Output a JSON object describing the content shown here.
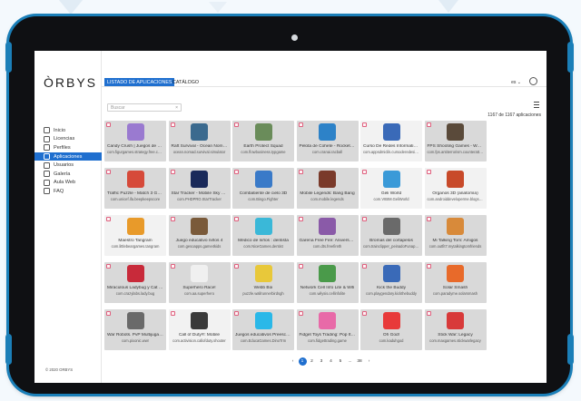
{
  "app": {
    "logo": "ÒRBYS",
    "copyright": "© 2020 ORBYS"
  },
  "tabs": [
    {
      "label": "LISTADO DE APLICACIONES",
      "active": true
    },
    {
      "label": "CATÁLOGO",
      "active": false
    }
  ],
  "header": {
    "language": "es ⌄"
  },
  "sidebar": {
    "items": [
      {
        "label": "Inicio",
        "icon": "home-icon",
        "active": false
      },
      {
        "label": "Licencias",
        "icon": "license-icon",
        "active": false
      },
      {
        "label": "Perfiles",
        "icon": "profiles-icon",
        "active": false
      },
      {
        "label": "Aplicaciones",
        "icon": "apps-icon",
        "active": true
      },
      {
        "label": "Usuarios",
        "icon": "users-icon",
        "active": false
      },
      {
        "label": "Galería",
        "icon": "gallery-icon",
        "active": false
      },
      {
        "label": "Aula Web",
        "icon": "globe-icon",
        "active": false
      },
      {
        "label": "FAQ",
        "icon": "help-icon",
        "active": false
      }
    ]
  },
  "search": {
    "placeholder": "Buscar",
    "clear": "×"
  },
  "results": {
    "count": "1167 de 1167 aplicaciones"
  },
  "apps": [
    {
      "title": "Candy Crush | Juegos de Gusims",
      "pkg": "com.figurgames.strategy.free.castles",
      "color": "#9a7ad0"
    },
    {
      "title": "Raft Survival - Ocean Nomad",
      "pkg": "ocean.nomad.survival.simulator",
      "color": "#3b6a8e"
    },
    {
      "title": "Earth Protect Squad",
      "pkg": "com.flowbusiness.typgame",
      "color": "#6a8c5a"
    },
    {
      "title": "Pelota de Cohete - Rocket Car",
      "pkg": "com.cranai.racball",
      "color": "#2d82c8"
    },
    {
      "title": "Curso De Redes Informaticas",
      "pkg": "com.appsdmiclik.cursoderedesinfor...",
      "color": "#3a6ab8",
      "selected": true
    },
    {
      "title": "FPS Shooting Games - War Games",
      "pkg": "com.fps.antiterrorism.counterattack.s...",
      "color": "#5a4a3a"
    },
    {
      "title": "Traffic Puzzle - Match 3 Game",
      "pkg": "com.unicef.ifa.beepkeepscore",
      "color": "#d64a3a"
    },
    {
      "title": "Star Tracker - Mobile Sky Map",
      "pkg": "com.PHDPRO.StarTracker",
      "color": "#1a2a5a"
    },
    {
      "title": "Combatiente de cielo 3D",
      "pkg": "com.Bingo.Fighter",
      "color": "#3a7ac8"
    },
    {
      "title": "Mobile Legends: Bang Bang",
      "pkg": "com.mobile.legends",
      "color": "#7a3a2a"
    },
    {
      "title": "Geli World",
      "pkg": "com.VIBIM.GeliWorld",
      "color": "#3a9ad8",
      "selected": true
    },
    {
      "title": "Órganos 3D (anatomía)",
      "pkg": "com.androiddeveloperme.blogspot.or...",
      "color": "#c84a2a",
      "selected": true
    },
    {
      "title": "Maestro Tangram",
      "pkg": "com.littlebeargames.tangram",
      "color": "#e89a2a",
      "selected": true
    },
    {
      "title": "Juego educativo niños 4",
      "pkg": "com.gesoapps.game4kids",
      "color": "#7a5a3a"
    },
    {
      "title": "Médico de niños : dentista",
      "pkg": "com.NiceGames.dentist",
      "color": "#3ab8d8"
    },
    {
      "title": "Garena Free Fire: Aniversario5",
      "pkg": "com.dts.freefireth",
      "color": "#8a5aa8"
    },
    {
      "title": "Bromas del cortapelos",
      "pkg": "com.trainclipper_peinadoFunapp21",
      "color": "#6a6a6a"
    },
    {
      "title": "Mi Talking Tom: Amigos",
      "pkg": "com.outfit7.mytalkingtomfriends",
      "color": "#d88a3a"
    },
    {
      "title": "Miraculous Ladybug y Cat Noir",
      "pkg": "com.crazylabs.lady.bug",
      "color": "#c82a3a"
    },
    {
      "title": "Superhero Race!",
      "pkg": "com.aa.superhero",
      "color": "#f0f0f0"
    },
    {
      "title": "Webb Boi",
      "pkg": "puzzle.wallrunnerbirdsgh",
      "color": "#e8c83a"
    },
    {
      "title": "Network Cell Info Lite & Wifi",
      "pkg": "com.wilysis.cellinfolite",
      "color": "#4a9a4a"
    },
    {
      "title": "Kick the Buddy",
      "pkg": "com.playgendary.kickthebuddy",
      "color": "#3a6ab8"
    },
    {
      "title": "Solar Smash",
      "pkg": "com.paradyme.solarsmash",
      "color": "#e86a2a"
    },
    {
      "title": "War Robots. PvP Multijugador",
      "pkg": "com.pixonic.wwr",
      "color": "#6a6a6a"
    },
    {
      "title": "Call of Duty®: Mobile",
      "pkg": "com.activision.callofduty.shooter",
      "color": "#3a3a3a",
      "selected": true
    },
    {
      "title": "Juegos educativos Preescolar",
      "pkg": "com.EducaGames.DinoTrm",
      "color": "#2ab8e8"
    },
    {
      "title": "Fidget Toys Trading: Pop It 3D",
      "pkg": "com.fidgettrading.game",
      "color": "#e86aa8"
    },
    {
      "title": "Oh God!",
      "pkg": "com.kaduhgod",
      "color": "#e83a3a"
    },
    {
      "title": "Stick War: Legacy",
      "pkg": "com.maxgames.stickwarlegacy",
      "color": "#d83a3a"
    }
  ],
  "pagination": {
    "prev": "‹",
    "pages": [
      "1",
      "2",
      "3",
      "4",
      "5",
      "...",
      "38"
    ],
    "next": "›",
    "current": "1"
  }
}
